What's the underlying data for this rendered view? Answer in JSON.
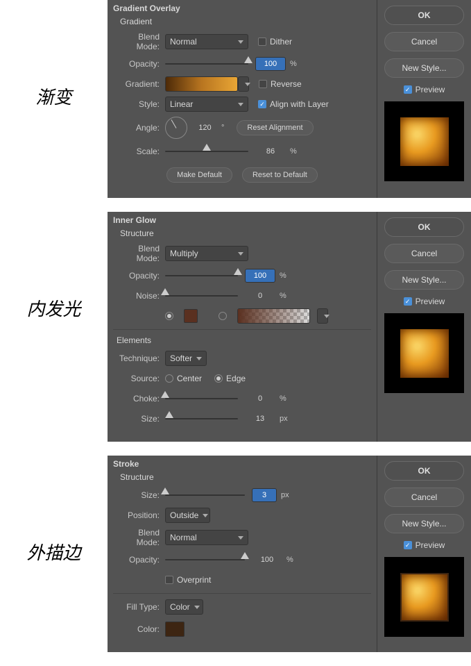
{
  "labels": {
    "s1": "渐变",
    "s2": "内发光",
    "s3": "外描边"
  },
  "common": {
    "ok": "OK",
    "cancel": "Cancel",
    "newstyle": "New Style...",
    "preview": "Preview",
    "make_default": "Make Default",
    "reset_default": "Reset to Default"
  },
  "gradient": {
    "title": "Gradient Overlay",
    "sub": "Gradient",
    "blend_mode_lbl": "Blend Mode:",
    "blend_mode": "Normal",
    "dither": "Dither",
    "opacity_lbl": "Opacity:",
    "opacity": "100",
    "opacity_unit": "%",
    "gradient_lbl": "Gradient:",
    "reverse": "Reverse",
    "style_lbl": "Style:",
    "style": "Linear",
    "align": "Align with Layer",
    "angle_lbl": "Angle:",
    "angle": "120",
    "angle_unit": "°",
    "reset_align": "Reset Alignment",
    "scale_lbl": "Scale:",
    "scale": "86",
    "scale_unit": "%"
  },
  "innerglow": {
    "title": "Inner Glow",
    "sub": "Structure",
    "blend_mode_lbl": "Blend Mode:",
    "blend_mode": "Multiply",
    "opacity_lbl": "Opacity:",
    "opacity": "100",
    "opacity_unit": "%",
    "noise_lbl": "Noise:",
    "noise": "0",
    "noise_unit": "%",
    "color": "#5a3020",
    "elements": "Elements",
    "technique_lbl": "Technique:",
    "technique": "Softer",
    "source_lbl": "Source:",
    "center": "Center",
    "edge": "Edge",
    "choke_lbl": "Choke:",
    "choke": "0",
    "choke_unit": "%",
    "size_lbl": "Size:",
    "size": "13",
    "size_unit": "px"
  },
  "stroke": {
    "title": "Stroke",
    "sub": "Structure",
    "size_lbl": "Size:",
    "size": "3",
    "size_unit": "px",
    "position_lbl": "Position:",
    "position": "Outside",
    "blend_mode_lbl": "Blend Mode:",
    "blend_mode": "Normal",
    "opacity_lbl": "Opacity:",
    "opacity": "100",
    "opacity_unit": "%",
    "overprint": "Overprint",
    "filltype_lbl": "Fill Type:",
    "filltype": "Color",
    "color_lbl": "Color:",
    "color": "#3d2512"
  }
}
